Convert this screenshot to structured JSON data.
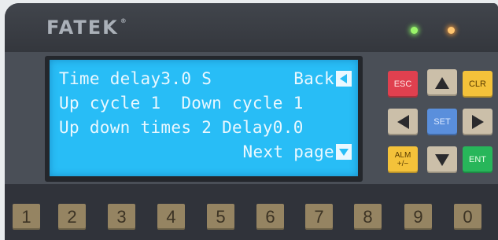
{
  "brand": {
    "name": "FATEK",
    "mark": "®"
  },
  "indicators": [
    {
      "name": "green-led",
      "color": "#9bf46a"
    },
    {
      "name": "orange-led",
      "color": "#ffc570"
    }
  ],
  "lcd": {
    "line1": "Time delay3.0 S",
    "back_label": "Back",
    "line2": "Up cycle 1  Down cycle 1",
    "line3": "Up down times 2 Delay0.0",
    "next_label": "Next page",
    "background_color": "#28bdf6"
  },
  "keys": {
    "esc": "ESC",
    "clr": "CLR",
    "set": "SET",
    "alm": "ALM",
    "alm_sub": "+/−",
    "ent": "ENT",
    "up_icon": "up-arrow-icon",
    "down_icon": "down-arrow-icon",
    "left_icon": "left-arrow-icon",
    "right_icon": "right-arrow-icon"
  },
  "number_keys": [
    "1",
    "2",
    "3",
    "4",
    "5",
    "6",
    "7",
    "8",
    "9",
    "0"
  ]
}
